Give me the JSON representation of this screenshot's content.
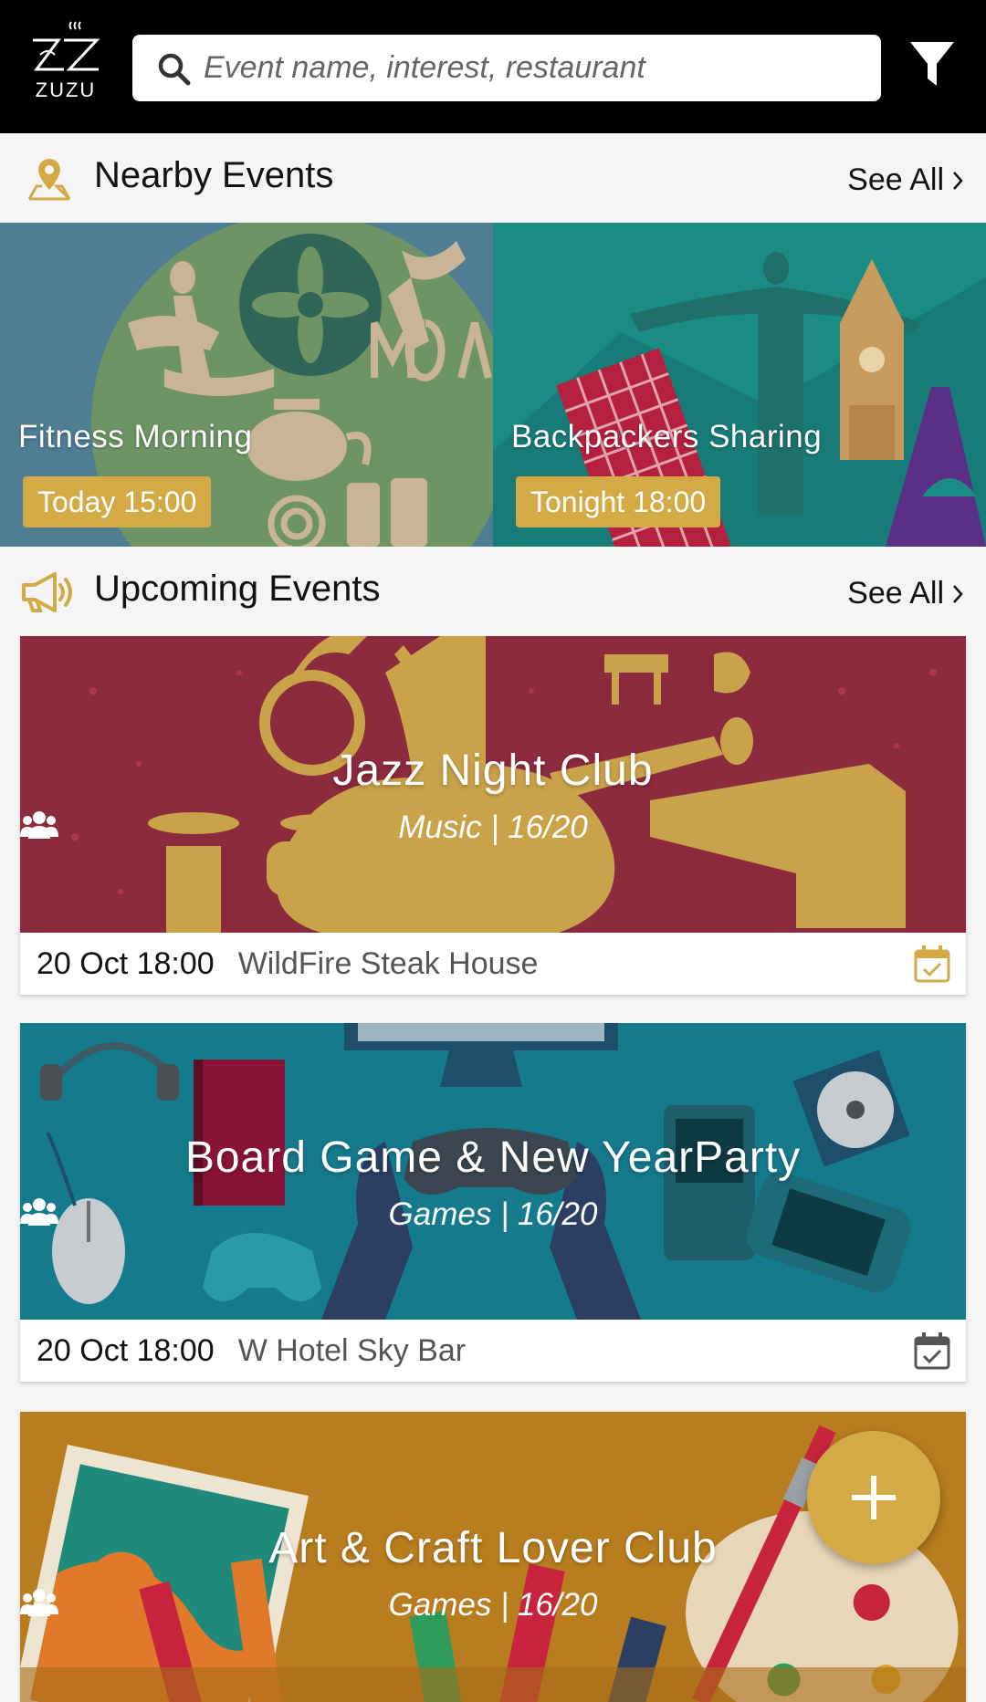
{
  "header": {
    "logo_text": "ZUZU",
    "search_placeholder": "Event name, interest, restaurant"
  },
  "nearby": {
    "title": "Nearby Events",
    "see_all": "See All",
    "items": [
      {
        "name": "Fitness Morning",
        "time": "Today 15:00"
      },
      {
        "name": "Backpackers Sharing",
        "time": "Tonight 18:00"
      }
    ]
  },
  "upcoming": {
    "title": "Upcoming Events",
    "see_all": "See All",
    "items": [
      {
        "title": "Jazz Night Club",
        "subtitle": "Music | 16/20",
        "date": "20 Oct 18:00",
        "place": "WildFire Steak House",
        "calendar_state": "added"
      },
      {
        "title": "Board Game & New YearParty",
        "subtitle": "Games | 16/20",
        "date": "20 Oct 18:00",
        "place": "W Hotel Sky Bar",
        "calendar_state": "added"
      },
      {
        "title": "Art & Craft Lover Club",
        "subtitle": "Games | 16/20"
      }
    ]
  },
  "colors": {
    "accent": "#d4aa47",
    "header_bg": "#000000",
    "jazz_bg": "#8c2a3e",
    "board_bg": "#147a8c",
    "art_bg": "#b77d1f"
  },
  "icons": {
    "search": "search-icon",
    "filter": "filter-icon",
    "location": "location-pin-icon",
    "megaphone": "megaphone-icon",
    "group": "group-icon",
    "calendar": "calendar-check-icon",
    "add": "plus-icon"
  }
}
